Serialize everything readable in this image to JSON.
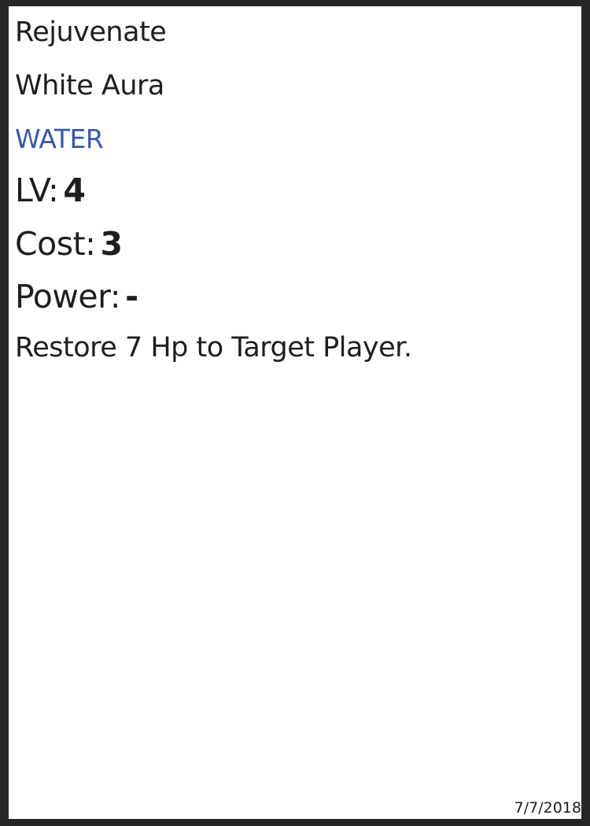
{
  "card": {
    "name": "Rejuvenate",
    "subtype": "White Aura",
    "element": "WATER",
    "element_color": "#3a58a6",
    "border_color": "#262626",
    "level_label": "LV:",
    "level_value": "4",
    "cost_label": "Cost:",
    "cost_value": "3",
    "power_label": "Power:",
    "power_value": "-",
    "effect": "Restore 7 Hp to Target Player.",
    "date": "7/7/2018"
  }
}
